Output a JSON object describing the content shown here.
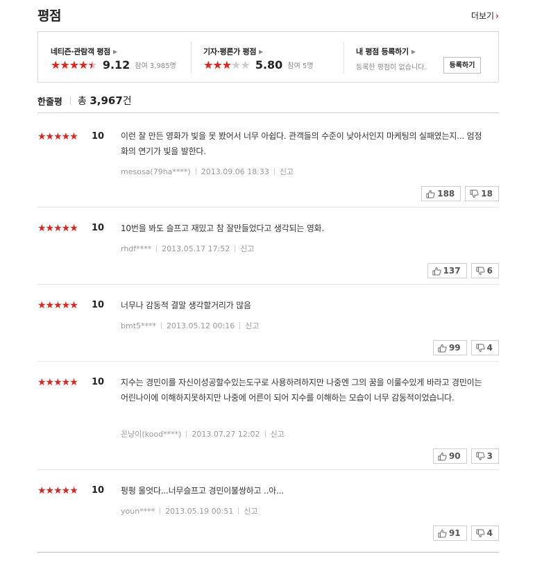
{
  "header": {
    "title": "평점",
    "more_label": "더보기"
  },
  "summary": {
    "netizen": {
      "title": "네티즌·관람객 평점",
      "score": "9.12",
      "participants": "참여 3,985명",
      "stars_filled": 4.5
    },
    "critic": {
      "title": "기자·평론가 평점",
      "score": "5.80",
      "participants": "참여 5명",
      "stars_filled": 3
    },
    "mine": {
      "title": "내 평점 등록하기",
      "empty_text": "등록한 평점이 없습니다.",
      "button_label": "등록하기"
    }
  },
  "reviews_header": {
    "label": "한줄평",
    "total_prefix": "총",
    "total_count": "3,967",
    "total_suffix": "건"
  },
  "reviews": [
    {
      "stars": "★★★★★",
      "score": "10",
      "text": "이런 잘 만든 영화가 빛을 못 봤어서 너무 아쉽다. 관객들의 수준이 낮아서인지 마케팅의 실패였는지... 엄정화의 연기가 빛을 발한다.",
      "user": "mesosa(79ha****)",
      "date": "2013.09.06 18:33",
      "report": "신고",
      "likes": "188",
      "dislikes": "18"
    },
    {
      "stars": "★★★★★",
      "score": "10",
      "text": "10번을 봐도 슬프고 재밌고 참 잘만들었다고 생각되는 영화.",
      "user": "rhdf****",
      "date": "2013.05.17 17:52",
      "report": "신고",
      "likes": "137",
      "dislikes": "6"
    },
    {
      "stars": "★★★★★",
      "score": "10",
      "text": "너무나 감동적 결말 생각할거리가 많음",
      "user": "bmt5****",
      "date": "2013.05.12 00:16",
      "report": "신고",
      "likes": "99",
      "dislikes": "4"
    },
    {
      "stars": "★★★★★",
      "score": "10",
      "text": "지수는 경민이를 자신이성공할수있는도구로 사용하려하지만 나중엔 그의 꿈을 이룰수있게 바라고 경민이는 어린나이에 이해하지못하지만 나중에 어른이 되어 지수를 이해하는 모습이 너무 감동적이었습니다.",
      "user": "꼰냥이(kood****)",
      "date": "2013.07.27 12:02",
      "report": "신고",
      "likes": "90",
      "dislikes": "3"
    },
    {
      "stars": "★★★★★",
      "score": "10",
      "text": "펑펑 울엇다...너무슬프고 경민이불쌍하고 ..아...",
      "user": "youn****",
      "date": "2013.05.19 00:51",
      "report": "신고",
      "likes": "91",
      "dislikes": "4"
    }
  ],
  "colors": {
    "accent": "#e2231a",
    "star_off": "#cccccc"
  }
}
